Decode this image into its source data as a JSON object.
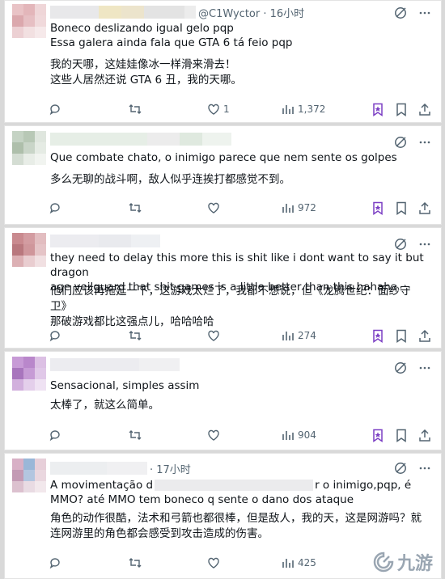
{
  "posts": [
    {
      "handle": "@C1Wyctor · 16小时",
      "original": [
        "Boneco deslizando igual gelo pqp",
        "Essa galera ainda fala que GTA 6 tá feio pqp"
      ],
      "translation": [
        "我的天哪，这娃娃像冰一样滑来滑去！",
        "这些人居然还说 GTA 6 丑，我的天哪。"
      ],
      "likes": "1",
      "views": "1,372"
    },
    {
      "handle": "",
      "original": [
        "Que combate chato, o inimigo parece que nem sente os golpes"
      ],
      "translation": [
        "多么无聊的战斗啊，敌人似乎连挨打都感觉不到。"
      ],
      "likes": "",
      "views": "972"
    },
    {
      "handle": "",
      "original": [
        "they need to delay this more this is shit like i dont want to say it but dragon",
        "age veilguard that shit games is a little better than this hahaha"
      ],
      "translation": [
        "他们应该再拖延一下，这游戏太烂了，我都不想说，但《龙腾世纪：面纱守卫》",
        "那破游戏都比这强点儿，哈哈哈哈"
      ],
      "likes": "",
      "views": "274"
    },
    {
      "handle": "",
      "original": [
        "Sensacional, simples assim"
      ],
      "translation": [
        "太棒了，就这么简单。"
      ],
      "likes": "",
      "views": "904"
    },
    {
      "handle": "· 17小时",
      "original_a": "A movimentação d",
      "original_b": "r o inimigo,pqp, é",
      "original_2": "MMO? até MMO tem boneco q sente o dano dos ataque",
      "translation": [
        "角色的动作很酷，法术和弓箭也都很棒，但是敌人，我的天，这是网游吗？就",
        "连网游里的角色都会感受到攻击造成的伤害。"
      ],
      "likes": "",
      "views": "425"
    }
  ],
  "watermark": "九游",
  "colors": {
    "muted": "#536471",
    "bookmark_purple": "#7b3fc4",
    "background": "#d9d9d9"
  },
  "icons": [
    "reply-icon",
    "retweet-icon",
    "like-icon",
    "views-icon",
    "bookmark-icon",
    "share-icon",
    "grok-icon",
    "more-icon"
  ]
}
